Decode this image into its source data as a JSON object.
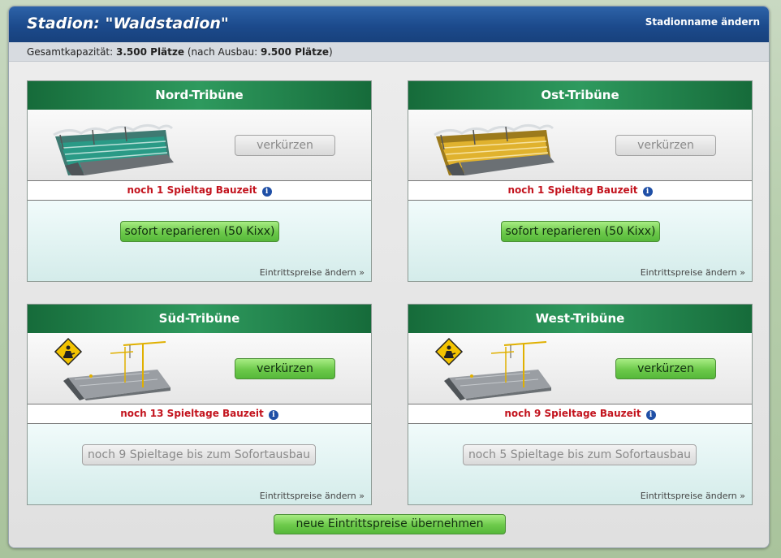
{
  "header": {
    "title": "Stadion: \"Waldstadion\"",
    "rename_link": "Stadionname ändern"
  },
  "capacity": {
    "label": "Gesamtkapazität:",
    "current": "3.500 Plätze",
    "after_label": "(nach Ausbau:",
    "after_value": "9.500 Plätze",
    "after_close": ")"
  },
  "stands": [
    {
      "name": "Nord-Tribüne",
      "shorten_label": "verkürzen",
      "build_time": "noch 1 Spieltag Bauzeit",
      "action_label": "sofort reparieren (50 Kixx)",
      "prices_link": "Eintrittspreise ändern »"
    },
    {
      "name": "Ost-Tribüne",
      "shorten_label": "verkürzen",
      "build_time": "noch 1 Spieltag Bauzeit",
      "action_label": "sofort reparieren (50 Kixx)",
      "prices_link": "Eintrittspreise ändern »"
    },
    {
      "name": "Süd-Tribüne",
      "shorten_label": "verkürzen",
      "build_time": "noch 13 Spieltage Bauzeit",
      "action_label": "noch 9 Spieltage bis zum Sofortausbau",
      "prices_link": "Eintrittspreise ändern »"
    },
    {
      "name": "West-Tribüne",
      "shorten_label": "verkürzen",
      "build_time": "noch 9 Spieltage Bauzeit",
      "action_label": "noch 5 Spieltage bis zum Sofortausbau",
      "prices_link": "Eintrittspreise ändern »"
    }
  ],
  "info_icon": "i",
  "apply_button": "neue Eintrittspreise übernehmen",
  "colors": {
    "header_blue": "#1c4a8c",
    "stand_header_green": "#2e9a5e",
    "build_time_red": "#c3141e",
    "button_green": "#6cc94a"
  }
}
